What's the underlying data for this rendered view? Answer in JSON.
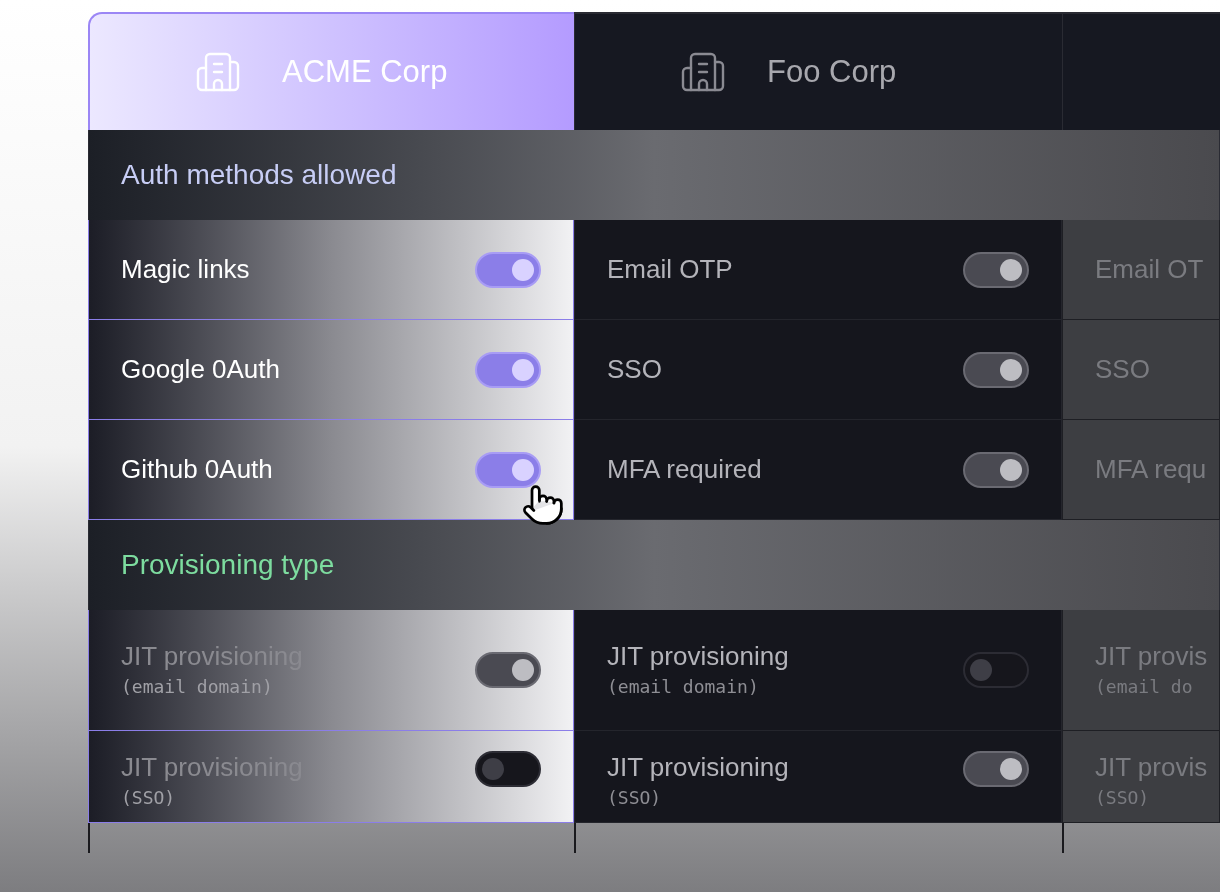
{
  "tabs": [
    {
      "label": "ACME Corp",
      "selected": true
    },
    {
      "label": "Foo Corp",
      "selected": false
    },
    {
      "selected": false
    }
  ],
  "sections": [
    {
      "title": "Auth methods allowed",
      "color": "#c7cdf5",
      "rows": [
        [
          {
            "kind": "toggle",
            "label": "Magic links",
            "on": true
          },
          {
            "kind": "toggle",
            "label": "Email OTP",
            "on": true
          },
          {
            "kind": "plain",
            "label": "Email OT"
          }
        ],
        [
          {
            "kind": "toggle",
            "label": "Google 0Auth",
            "on": true
          },
          {
            "kind": "toggle",
            "label": "SSO",
            "on": true
          },
          {
            "kind": "plain",
            "label": "SSO"
          }
        ],
        [
          {
            "kind": "toggle",
            "label": "Github 0Auth",
            "on": true,
            "pointer": true
          },
          {
            "kind": "toggle",
            "label": "MFA required",
            "on": true
          },
          {
            "kind": "plain",
            "label": "MFA requ"
          }
        ]
      ]
    },
    {
      "title": "Provisioning type",
      "color": "#7ddc9f",
      "rows": [
        [
          {
            "kind": "toggle",
            "label": "JIT provisioning",
            "sublabel": "(email domain)",
            "on": true
          },
          {
            "kind": "toggle",
            "label": "JIT provisioning",
            "sublabel": "(email domain)",
            "on": false
          },
          {
            "kind": "plain",
            "label": "JIT provis",
            "sublabel": "(email do"
          }
        ],
        [
          {
            "kind": "toggle",
            "label": "JIT provisioning",
            "sublabel": "(SSO)",
            "on": false
          },
          {
            "kind": "toggle",
            "label": "JIT provisioning",
            "sublabel": "(SSO)",
            "on": true
          },
          {
            "kind": "plain",
            "label": "JIT provis",
            "sublabel": "(SSO)"
          }
        ]
      ]
    }
  ]
}
